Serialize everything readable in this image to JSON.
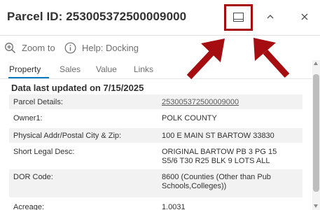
{
  "header": {
    "title": "Parcel ID: 253005372500009000"
  },
  "toolbar": {
    "zoom_label": "Zoom to",
    "help_label": "Help: Docking"
  },
  "tabs": [
    {
      "label": "Property",
      "active": true
    },
    {
      "label": "Sales",
      "active": false
    },
    {
      "label": "Value",
      "active": false
    },
    {
      "label": "Links",
      "active": false
    }
  ],
  "content": {
    "updated": "Data last updated on 7/15/2025",
    "rows": [
      {
        "key": "Parcel Details:",
        "value": "253005372500009000"
      },
      {
        "key": "Owner1:",
        "value": "POLK COUNTY"
      },
      {
        "key": "Physical Addr/Postal City & Zip:",
        "value": "100 E MAIN ST BARTOW 33830"
      },
      {
        "key": "Short Legal Desc:",
        "value_lines": [
          "ORIGINAL BARTOW PB 3 PG 15",
          "S5/6 T30 R25 BLK 9 LOTS ALL"
        ]
      },
      {
        "key": "DOR Code:",
        "value_lines": [
          "8600 (Counties (Other than Pub",
          "Schools,Colleges))"
        ]
      },
      {
        "key": "Acreage:",
        "value": "1.0031"
      }
    ]
  },
  "icons": {
    "dock": "dock-bottom-icon",
    "collapse": "chevron-up-icon",
    "close": "close-icon",
    "zoom": "zoom-in-icon",
    "help": "info-icon"
  },
  "colors": {
    "highlight": "#a50d10",
    "tab_accent": "#0079c1"
  }
}
